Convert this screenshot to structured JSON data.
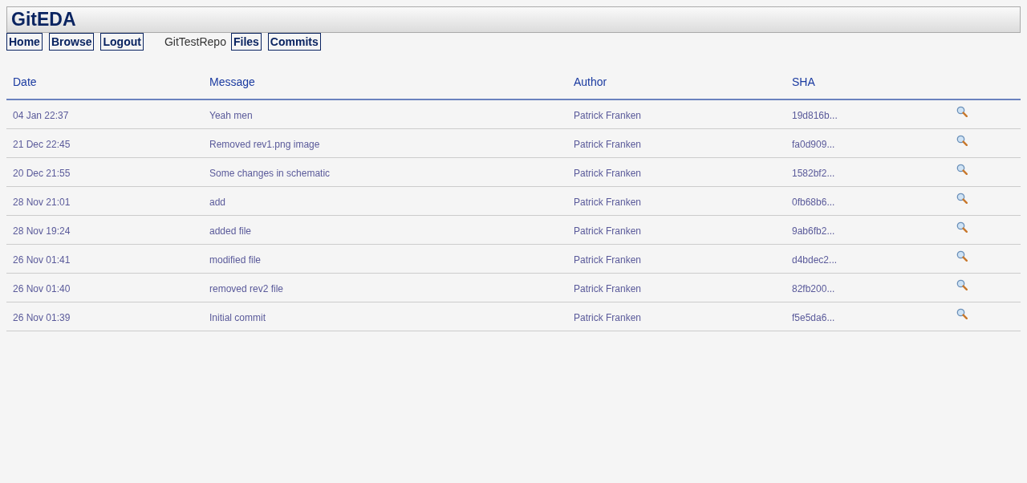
{
  "header": {
    "title": "GitEDA"
  },
  "nav": [
    {
      "kind": "link",
      "label": "Home"
    },
    {
      "kind": "link",
      "label": "Browse"
    },
    {
      "kind": "link",
      "label": "Logout"
    },
    {
      "kind": "text",
      "label": "GitTestRepo"
    },
    {
      "kind": "link",
      "label": "Files"
    },
    {
      "kind": "link",
      "label": "Commits"
    }
  ],
  "table": {
    "columns": [
      "Date",
      "Message",
      "Author",
      "SHA"
    ],
    "rows": [
      {
        "date": "04 Jan 22:37",
        "message": "Yeah men",
        "author": "Patrick Franken",
        "sha": "19d816b..."
      },
      {
        "date": "21 Dec 22:45",
        "message": "Removed rev1.png image",
        "author": "Patrick Franken",
        "sha": "fa0d909..."
      },
      {
        "date": "20 Dec 21:55",
        "message": "Some changes in schematic",
        "author": "Patrick Franken",
        "sha": "1582bf2..."
      },
      {
        "date": "28 Nov 21:01",
        "message": "add",
        "author": "Patrick Franken",
        "sha": "0fb68b6..."
      },
      {
        "date": "28 Nov 19:24",
        "message": "added file",
        "author": "Patrick Franken",
        "sha": "9ab6fb2..."
      },
      {
        "date": "26 Nov 01:41",
        "message": "modified file",
        "author": "Patrick Franken",
        "sha": "d4bdec2..."
      },
      {
        "date": "26 Nov 01:40",
        "message": "removed rev2 file",
        "author": "Patrick Franken",
        "sha": "82fb200..."
      },
      {
        "date": "26 Nov 01:39",
        "message": "Initial commit",
        "author": "Patrick Franken",
        "sha": "f5e5da6..."
      }
    ]
  }
}
